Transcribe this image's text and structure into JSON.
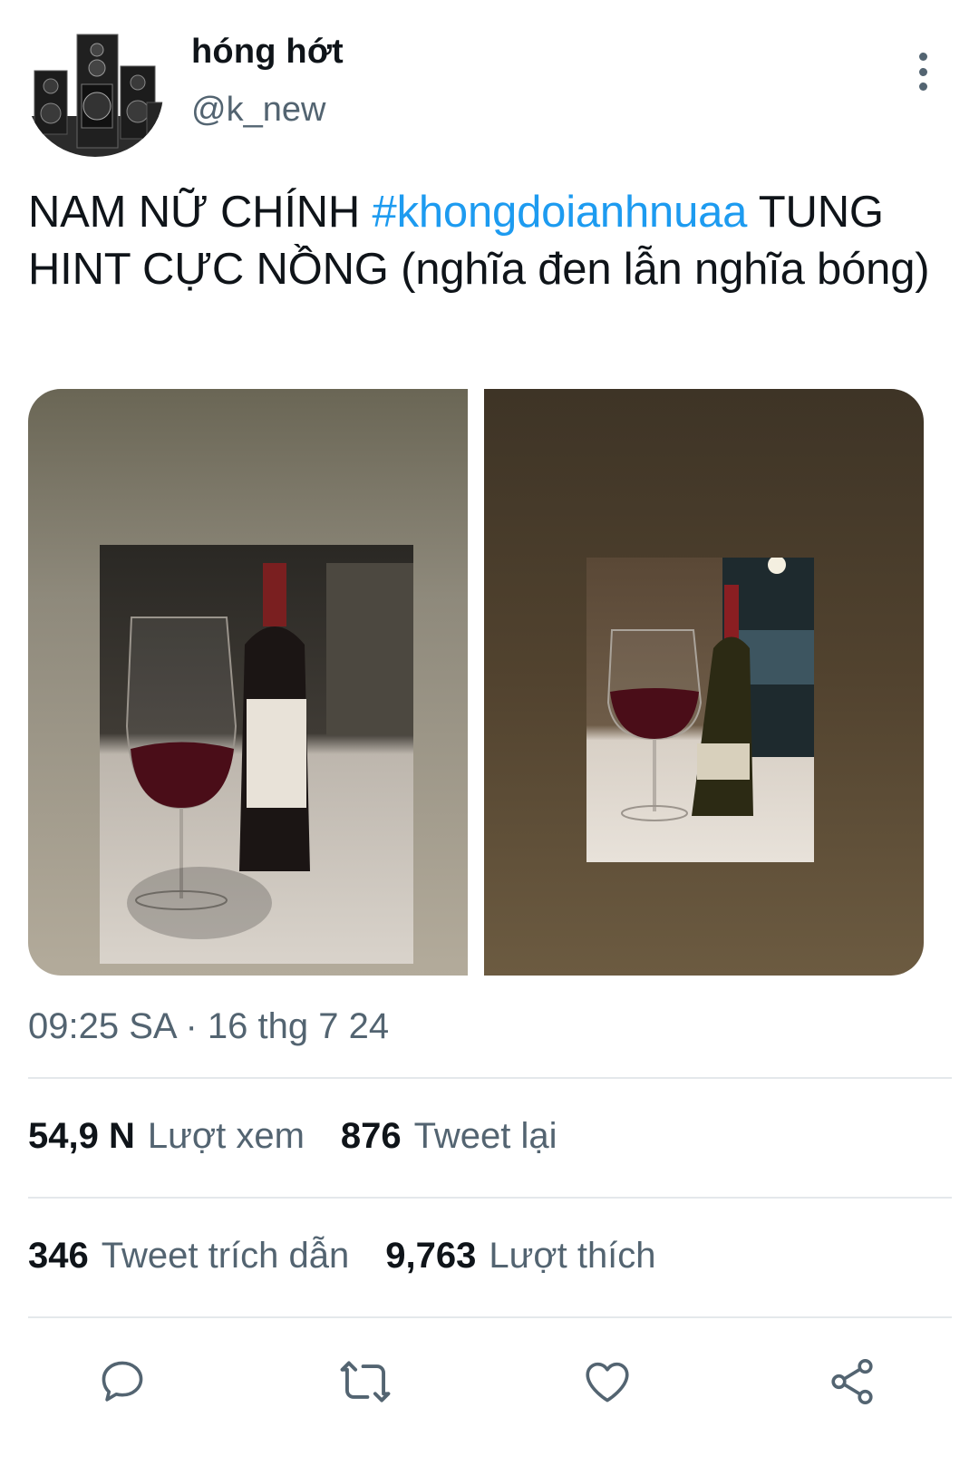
{
  "author": {
    "display_name": "hóng hớt",
    "handle": "@k_new",
    "avatar_icon": "speaker-system-avatar"
  },
  "tweet": {
    "text_before": "NAM NỮ CHÍNH ",
    "hashtag": "#khongdoianhnuaa",
    "text_after": " TUNG HINT CỰC NỒNG (nghĩa đen lẫn nghĩa bóng)",
    "media": [
      {
        "description": "red wine glass with bottle on patterned tablecloth"
      },
      {
        "description": "red wine glass with bottle by window at night"
      }
    ]
  },
  "timestamp": "09:25 SA · 16 thg 7 24",
  "stats": {
    "views_count": "54,9 N",
    "views_label": "Lượt xem",
    "retweets_count": "876",
    "retweets_label": "Tweet lại",
    "quotes_count": "346",
    "quotes_label": "Tweet trích dẫn",
    "likes_count": "9,763",
    "likes_label": "Lượt thích"
  },
  "actions": [
    "reply-icon",
    "retweet-icon",
    "like-icon",
    "share-icon"
  ],
  "colors": {
    "hashtag": "#1d9bf0",
    "secondary_text": "#536471",
    "primary_text": "#0f1419",
    "divider": "#e4e8eb"
  }
}
